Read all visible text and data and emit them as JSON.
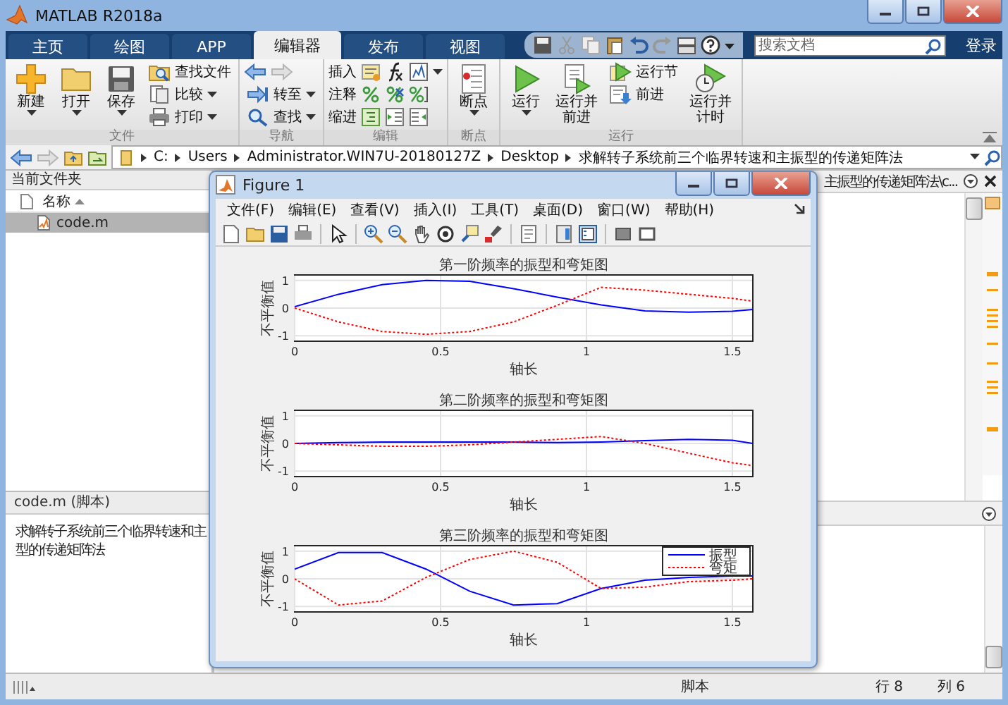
{
  "window": {
    "title": "MATLAB R2018a"
  },
  "tabs": [
    {
      "label": "主页",
      "selected": false
    },
    {
      "label": "绘图",
      "selected": false
    },
    {
      "label": "APP",
      "selected": false
    },
    {
      "label": "编辑器",
      "selected": true
    },
    {
      "label": "发布",
      "selected": false
    },
    {
      "label": "视图",
      "selected": false
    }
  ],
  "search": {
    "placeholder": "搜索文档"
  },
  "login": "登录",
  "ribbon": {
    "groups": [
      {
        "kind": "file",
        "title": "文件",
        "buttons": [
          {
            "label": "新建",
            "kind": "large",
            "dropdown": true
          },
          {
            "label": "打开",
            "kind": "large",
            "dropdown": true
          },
          {
            "label": "保存",
            "kind": "large",
            "dropdown": true
          },
          {
            "label": "查找文件",
            "kind": "small",
            "dropdown": false
          },
          {
            "label": "比较",
            "kind": "small",
            "dropdown": true
          },
          {
            "label": "打印",
            "kind": "small",
            "dropdown": true
          }
        ]
      },
      {
        "kind": "nav",
        "title": "导航",
        "buttons": [
          {
            "label": "转至",
            "dropdown": true
          },
          {
            "label": "查找",
            "dropdown": true
          }
        ]
      },
      {
        "kind": "edit",
        "title": "编辑",
        "buttons": [
          {
            "label": "插入",
            "dropdown": true
          },
          {
            "label": "注释",
            "dropdown": false
          },
          {
            "label": "缩进",
            "dropdown": false
          }
        ]
      },
      {
        "kind": "breakpoints",
        "title": "断点",
        "buttons": [
          {
            "label": "断点",
            "kind": "large",
            "dropdown": true
          }
        ]
      },
      {
        "kind": "run",
        "title": "运行",
        "buttons": [
          {
            "label": "运行",
            "kind": "large",
            "dropdown": true
          },
          {
            "label": "运行并前进",
            "kind": "large",
            "dropdown": false
          },
          {
            "label": "运行节",
            "kind": "small",
            "dropdown": false
          },
          {
            "label": "前进",
            "kind": "small",
            "dropdown": false
          },
          {
            "label": "运行并计时",
            "kind": "large",
            "dropdown": false
          }
        ]
      }
    ]
  },
  "address": {
    "path": [
      "C:",
      "Users",
      "Administrator.WIN7U-20180127Z",
      "Desktop",
      "求解转子系统前三个临界转速和主振型的传递矩阵法"
    ]
  },
  "current_folder": {
    "title": "当前文件夹",
    "column": "名称",
    "files": [
      {
        "name": "code.m",
        "selected": true
      }
    ]
  },
  "details": {
    "title": "code.m  (脚本)",
    "lines": [
      "求解转子系统前三个临界转速和主",
      "型的传递矩阵法"
    ]
  },
  "editor": {
    "tab_title": "主振型的传递矩阵法\\c..."
  },
  "status_bar": {
    "type": "脚本",
    "line": "行  8",
    "column": "列  6"
  },
  "figure": {
    "title": "Figure 1",
    "menu": [
      "文件(F)",
      "编辑(E)",
      "查看(V)",
      "插入(I)",
      "工具(T)",
      "桌面(D)",
      "窗口(W)",
      "帮助(H)"
    ],
    "subplots": [
      {
        "chart_data": {
          "type": "line",
          "title": "第一阶频率的振型和弯矩图",
          "xlabel": "轴长",
          "ylabel": "不平衡值",
          "x": [
            0,
            0.15,
            0.3,
            0.45,
            0.6,
            0.75,
            0.9,
            1.05,
            1.2,
            1.35,
            1.5,
            1.57
          ],
          "series": [
            {
              "color": "#0000ff",
              "line_style": "solid",
              "values": [
                0.05,
                0.5,
                0.85,
                1.0,
                0.97,
                0.7,
                0.4,
                0.12,
                -0.1,
                -0.15,
                -0.12,
                -0.05
              ]
            },
            {
              "color": "#ff0000",
              "line_style": "dotted",
              "values": [
                0,
                -0.5,
                -0.85,
                -0.95,
                -0.85,
                -0.5,
                0.1,
                0.75,
                0.65,
                0.5,
                0.35,
                0.25
              ]
            }
          ],
          "xlim": [
            0,
            1.57
          ],
          "ylim": [
            -1.2,
            1.2
          ],
          "xticks": [
            0,
            0.5,
            1,
            1.5
          ],
          "yticks": [
            -1,
            0,
            1
          ],
          "grid": true
        }
      },
      {
        "chart_data": {
          "type": "line",
          "title": "第二阶频率的振型和弯矩图",
          "xlabel": "轴长",
          "ylabel": "不平衡值",
          "x": [
            0,
            0.15,
            0.3,
            0.45,
            0.6,
            0.75,
            0.9,
            1.05,
            1.2,
            1.35,
            1.5,
            1.57
          ],
          "series": [
            {
              "color": "#0000ff",
              "line_style": "solid",
              "values": [
                0,
                0.03,
                0.05,
                0.05,
                0.05,
                0.05,
                0.03,
                0.05,
                0.1,
                0.15,
                0.12,
                0
              ]
            },
            {
              "color": "#ff0000",
              "line_style": "dotted",
              "values": [
                0,
                -0.05,
                -0.1,
                -0.1,
                -0.05,
                0.05,
                0.15,
                0.25,
                0,
                -0.35,
                -0.7,
                -0.8
              ]
            }
          ],
          "xlim": [
            0,
            1.57
          ],
          "ylim": [
            -1.2,
            1.2
          ],
          "xticks": [
            0,
            0.5,
            1,
            1.5
          ],
          "yticks": [
            -1,
            0,
            1
          ],
          "grid": true
        }
      },
      {
        "chart_data": {
          "type": "line",
          "title": "第三阶频率的振型和弯矩图",
          "xlabel": "轴长",
          "ylabel": "不平衡值",
          "x": [
            0,
            0.15,
            0.3,
            0.45,
            0.6,
            0.75,
            0.9,
            1.05,
            1.2,
            1.35,
            1.5,
            1.57
          ],
          "series": [
            {
              "name": "振型",
              "color": "#0000ff",
              "line_style": "solid",
              "values": [
                0.35,
                0.95,
                0.95,
                0.35,
                -0.45,
                -0.95,
                -0.9,
                -0.35,
                -0.05,
                0.05,
                0.1,
                0.1
              ]
            },
            {
              "name": "弯矩",
              "color": "#ff0000",
              "line_style": "dotted",
              "values": [
                0,
                -0.95,
                -0.8,
                0.05,
                0.7,
                1.0,
                0.6,
                -0.35,
                -0.3,
                -0.1,
                -0.05,
                0
              ]
            }
          ],
          "xlim": [
            0,
            1.57
          ],
          "ylim": [
            -1.2,
            1.2
          ],
          "xticks": [
            0,
            0.5,
            1,
            1.5
          ],
          "yticks": [
            -1,
            0,
            1
          ],
          "grid": true,
          "legend": true
        }
      }
    ]
  }
}
